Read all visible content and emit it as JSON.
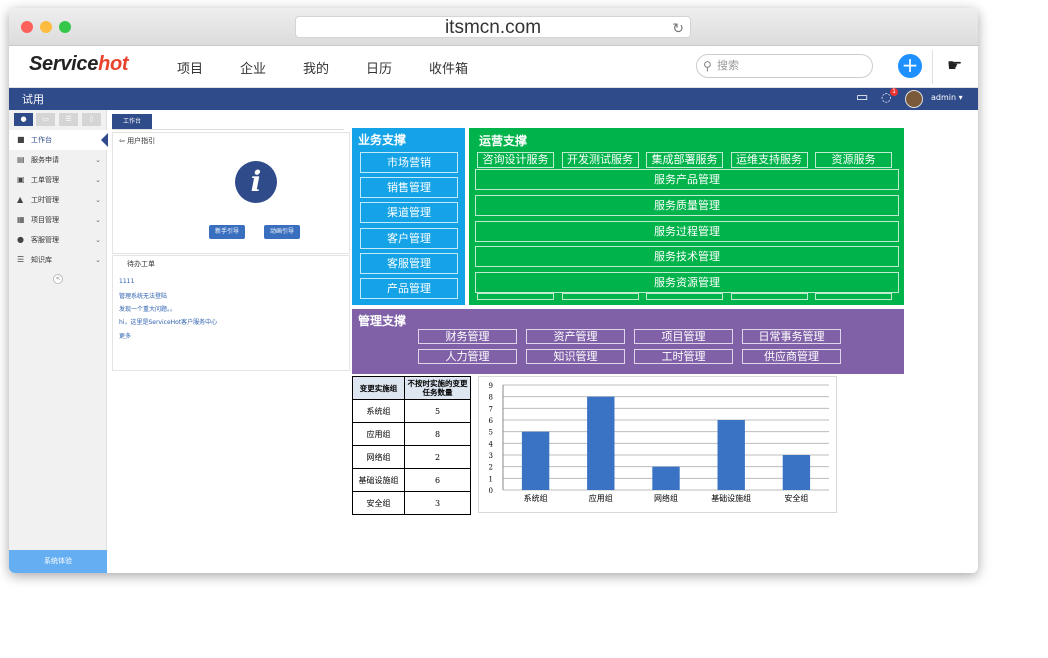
{
  "browser": {
    "url": "itsmcn.com",
    "dot_colors": [
      "#fc605b",
      "#fdbc40",
      "#34c84a"
    ]
  },
  "app": {
    "logo_prefix": "Service",
    "logo_suffix": "hot",
    "nav": [
      "项目",
      "企业",
      "我的",
      "日历",
      "收件箱"
    ],
    "search_placeholder": "搜索",
    "plus_label": "+"
  },
  "topbar": {
    "title": "试用",
    "user": "admin",
    "notification_count": "1"
  },
  "sidebar": {
    "items": [
      {
        "label": "工作台",
        "icon": "windows-icon",
        "glyph": "■"
      },
      {
        "label": "服务申请",
        "icon": "book-icon",
        "glyph": "▤"
      },
      {
        "label": "工单管理",
        "icon": "rss-icon",
        "glyph": "▣"
      },
      {
        "label": "工时管理",
        "icon": "road-icon",
        "glyph": "▲"
      },
      {
        "label": "项目管理",
        "icon": "table-icon",
        "glyph": "▦"
      },
      {
        "label": "客服管理",
        "icon": "user-icon",
        "glyph": "●"
      },
      {
        "label": "知识库",
        "icon": "list-icon",
        "glyph": "☰"
      }
    ],
    "bottom_button": "系统体验",
    "collapse_glyph": "<"
  },
  "workspace": {
    "tab": "工作台",
    "guide_title": "用户指引",
    "guide_buttons": [
      "新手引导",
      "动画引导"
    ],
    "todo_title": "待办工单",
    "todo_items": [
      "1111",
      "管理系统无法登陆",
      "发现一个重大问题。。",
      "hi，这里是ServiceHot客户服务中心"
    ],
    "more": "更多"
  },
  "panels": {
    "business": {
      "title": "业务支撑",
      "items": [
        "市场营销",
        "销售管理",
        "渠道管理",
        "客户管理",
        "客服管理",
        "产品管理"
      ],
      "color": "#13a3e6"
    },
    "operations": {
      "title": "运营支撑",
      "top_items": [
        "咨询设计服务",
        "开发测试服务",
        "集成部署服务",
        "运维支持服务",
        "资源服务"
      ],
      "rows": [
        "服务产品管理",
        "服务质量管理",
        "服务过程管理",
        "服务技术管理",
        "服务资源管理"
      ],
      "color": "#00b34a"
    },
    "management": {
      "title": "管理支撑",
      "items": [
        "财务管理",
        "资产管理",
        "项目管理",
        "日常事务管理",
        "人力管理",
        "知识管理",
        "工时管理",
        "供应商管理"
      ],
      "color": "#8061a8"
    }
  },
  "summary_table": {
    "headers": [
      "变更实施组",
      "不按时实施的变更任务数量"
    ],
    "rows": [
      [
        "系统组",
        "5"
      ],
      [
        "应用组",
        "8"
      ],
      [
        "网络组",
        "2"
      ],
      [
        "基础设施组",
        "6"
      ],
      [
        "安全组",
        "3"
      ]
    ]
  },
  "chart_data": {
    "type": "bar",
    "categories": [
      "系统组",
      "应用组",
      "网络组",
      "基础设施组",
      "安全组"
    ],
    "values": [
      5,
      8,
      2,
      6,
      3
    ],
    "ylim": [
      0,
      9
    ],
    "yticks": [
      0,
      1,
      2,
      3,
      4,
      5,
      6,
      7,
      8,
      9
    ],
    "grid": true,
    "bar_color": "#3a72c4"
  }
}
